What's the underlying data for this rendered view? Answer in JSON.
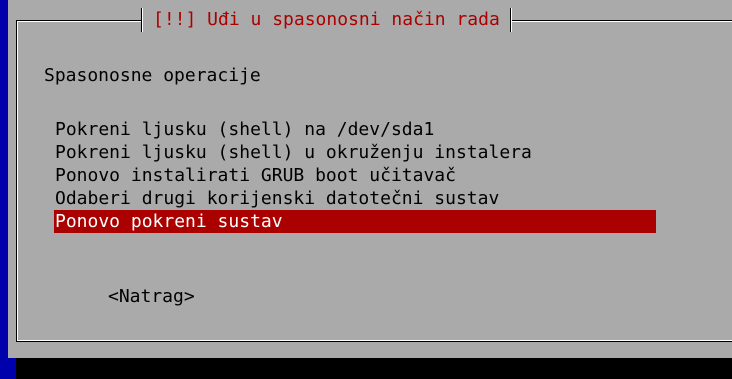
{
  "colors": {
    "background": "#0000ac",
    "dialog": "#aaaaaa",
    "title": "#aa0000",
    "selection": "#aa0000",
    "selection_text": "#ffffff"
  },
  "dialog": {
    "title": "[!!] Uđi u spasonosni način rada",
    "heading": "Spasonosne operacije",
    "menu": {
      "items": [
        "Pokreni ljusku (shell) na /dev/sda1",
        "Pokreni ljusku (shell) u okruženju instalera",
        "Ponovo instalirati GRUB boot učitavač",
        "Odaberi drugi korijenski datotečni sustav",
        "Ponovo pokreni sustav"
      ],
      "selected_index": 4
    },
    "back_button": "<Natrag>"
  }
}
